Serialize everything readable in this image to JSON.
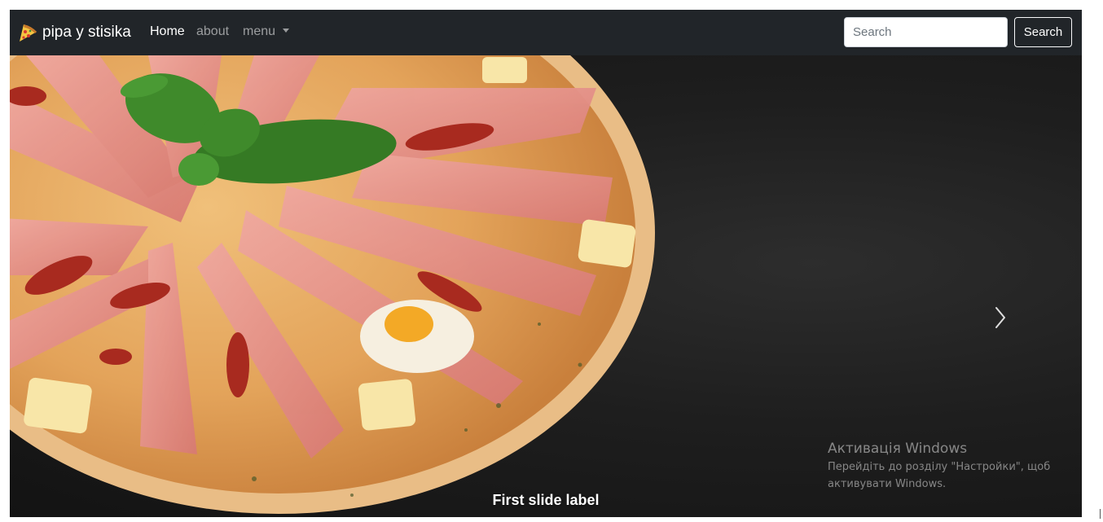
{
  "navbar": {
    "brand": "pipa y stisika",
    "brand_icon": "pizza-slice-icon",
    "links": [
      {
        "label": "Home",
        "active": true
      },
      {
        "label": "about",
        "active": false
      },
      {
        "label": "menu",
        "dropdown": true
      }
    ],
    "search": {
      "placeholder": "Search",
      "value": "",
      "button_label": "Search"
    },
    "colors": {
      "background": "#212529",
      "active": "#ffffff",
      "inactive": "rgba(255,255,255,0.55)"
    }
  },
  "carousel": {
    "slide_caption": "First slide label",
    "next_icon": "chevron-right-icon",
    "image_subject": "pizza-with-prosciutto-basil-egg"
  },
  "watermark": {
    "title": "Активація Windows",
    "line1": "Перейдіть до розділу \"Настройки\", щоб",
    "line2": "активувати Windows."
  }
}
